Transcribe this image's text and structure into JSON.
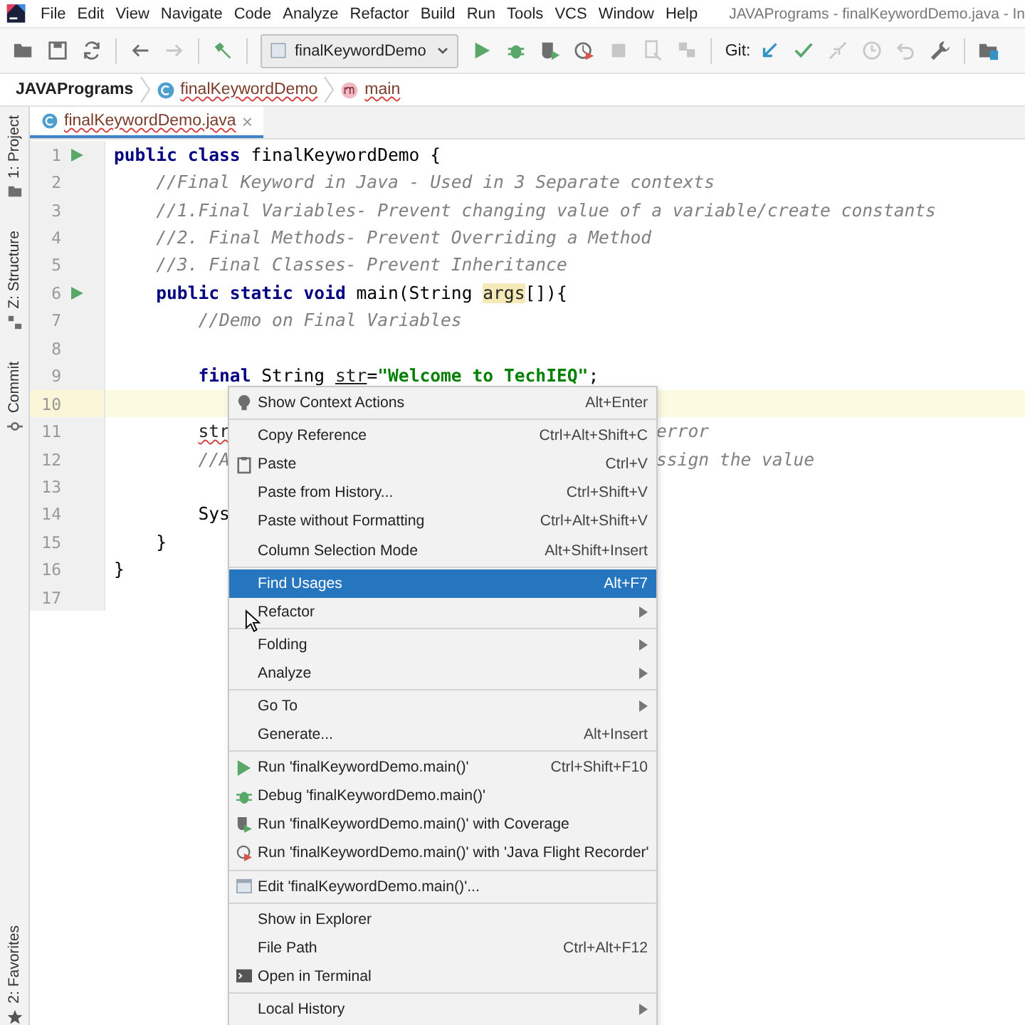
{
  "menu_bar": {
    "items": [
      "File",
      "Edit",
      "View",
      "Navigate",
      "Code",
      "Analyze",
      "Refactor",
      "Build",
      "Run",
      "Tools",
      "VCS",
      "Window",
      "Help"
    ],
    "title": "JAVAPrograms - finalKeywordDemo.java - In"
  },
  "toolbar": {
    "buttons": [
      {
        "kind": "open",
        "disabled": false
      },
      {
        "kind": "save",
        "disabled": false
      },
      {
        "kind": "sync",
        "disabled": false
      },
      {
        "kind": "back",
        "disabled": false
      },
      {
        "kind": "forward",
        "disabled": true
      },
      {
        "kind": "build",
        "disabled": false
      },
      {
        "kind": "config",
        "label": "finalKeywordDemo",
        "disabled": false
      },
      {
        "kind": "run",
        "disabled": false
      },
      {
        "kind": "debug",
        "disabled": false
      },
      {
        "kind": "coverage",
        "disabled": false
      },
      {
        "kind": "profile",
        "disabled": false
      },
      {
        "kind": "stop",
        "disabled": true
      },
      {
        "kind": "attach",
        "disabled": true
      },
      {
        "kind": "deploy",
        "disabled": true
      },
      {
        "kind": "git",
        "label": "Git:",
        "disabled": false
      },
      {
        "kind": "update",
        "disabled": false
      },
      {
        "kind": "commit",
        "disabled": false
      },
      {
        "kind": "merge",
        "disabled": true
      },
      {
        "kind": "history",
        "disabled": true
      },
      {
        "kind": "rollback",
        "disabled": true
      },
      {
        "kind": "settings",
        "disabled": false
      },
      {
        "kind": "structure",
        "disabled": false
      }
    ]
  },
  "breadcrumbs": [
    {
      "kind": "project",
      "text": "JAVAPrograms",
      "error": false
    },
    {
      "kind": "class",
      "text": "finalKeywordDemo",
      "error": true
    },
    {
      "kind": "method",
      "text": "main",
      "error": true
    }
  ],
  "side_stripe": [
    {
      "kind": "project",
      "label": "1: Project"
    },
    {
      "kind": "structure",
      "label": "Z: Structure"
    },
    {
      "kind": "commit",
      "label": "Commit"
    },
    {
      "kind": "favorites",
      "label": "2: Favorites"
    }
  ],
  "tabs": [
    {
      "label": "finalKeywordDemo.java",
      "selected": true,
      "error": true,
      "close": "×"
    }
  ],
  "editor": {
    "lines": [
      {
        "number": "1",
        "run_marker": true,
        "current": false,
        "segments": [
          {
            "kind": "keyword",
            "text": "public class "
          },
          {
            "kind": "plain",
            "text": "finalKeywordDemo {"
          }
        ]
      },
      {
        "number": "2",
        "run_marker": false,
        "current": false,
        "segments": [
          {
            "kind": "comment",
            "text": "    //Final Keyword in Java - Used in 3 Separate contexts"
          }
        ]
      },
      {
        "number": "3",
        "run_marker": false,
        "current": false,
        "segments": [
          {
            "kind": "comment",
            "text": "    //1.Final Variables- Prevent changing value of a variable/create constants"
          }
        ]
      },
      {
        "number": "4",
        "run_marker": false,
        "current": false,
        "segments": [
          {
            "kind": "comment",
            "text": "    //2. Final Methods- Prevent Overriding a Method"
          }
        ]
      },
      {
        "number": "5",
        "run_marker": false,
        "current": false,
        "segments": [
          {
            "kind": "comment",
            "text": "    //3. Final Classes- Prevent Inheritance"
          }
        ]
      },
      {
        "number": "6",
        "run_marker": true,
        "current": false,
        "segments": [
          {
            "kind": "keyword",
            "text": "    public static void "
          },
          {
            "kind": "plain",
            "text": "main(String "
          },
          {
            "kind": "param",
            "text": "args"
          },
          {
            "kind": "plain",
            "text": "[]){"
          }
        ]
      },
      {
        "number": "7",
        "run_marker": false,
        "current": false,
        "segments": [
          {
            "kind": "comment",
            "text": "        //Demo on Final Variables"
          }
        ]
      },
      {
        "number": "8",
        "run_marker": false,
        "current": false
      },
      {
        "number": "9",
        "run_marker": false,
        "current": false,
        "segments": [
          {
            "kind": "keyword",
            "text": "        final "
          },
          {
            "kind": "plain",
            "text": "String "
          },
          {
            "kind": "underlined",
            "text": "str"
          },
          {
            "kind": "plain",
            "text": "="
          },
          {
            "kind": "string",
            "text": "\"Welcome to TechIEQ\""
          },
          {
            "kind": "plain",
            "text": ";"
          }
        ]
      },
      {
        "number": "10",
        "run_marker": false,
        "current": true
      },
      {
        "number": "11",
        "run_marker": false,
        "current": false,
        "segments": [
          {
            "kind": "error",
            "text": "        str"
          }
        ],
        "tail": "error"
      },
      {
        "number": "12",
        "run_marker": false,
        "current": false,
        "segments": [
          {
            "kind": "comment",
            "text": "        //A"
          }
        ],
        "tail": "ssign the value"
      },
      {
        "number": "13",
        "run_marker": false,
        "current": false
      },
      {
        "number": "14",
        "run_marker": false,
        "current": false,
        "segments": [
          {
            "kind": "plain",
            "text": "        Sys"
          }
        ]
      },
      {
        "number": "15",
        "run_marker": false,
        "current": false,
        "segments": [
          {
            "kind": "plain",
            "text": "    }"
          }
        ]
      },
      {
        "number": "16",
        "run_marker": false,
        "current": false,
        "segments": [
          {
            "kind": "plain",
            "text": "}"
          }
        ]
      },
      {
        "number": "17",
        "run_marker": false,
        "current": false
      }
    ]
  },
  "context_menu": {
    "items": [
      {
        "kind": "bulb",
        "label": "Show Context Actions",
        "shortcut": "Alt+Enter",
        "submenu": false,
        "selected": false
      },
      {
        "kind": "separator"
      },
      {
        "kind": "item",
        "label": "Copy Reference",
        "shortcut": "Ctrl+Alt+Shift+C",
        "submenu": false,
        "selected": false
      },
      {
        "kind": "clipboard",
        "label": "Paste",
        "shortcut": "Ctrl+V",
        "submenu": false,
        "selected": false
      },
      {
        "kind": "item",
        "label": "Paste from History...",
        "shortcut": "Ctrl+Shift+V",
        "submenu": false,
        "selected": false
      },
      {
        "kind": "item",
        "label": "Paste without Formatting",
        "shortcut": "Ctrl+Alt+Shift+V",
        "submenu": false,
        "selected": false
      },
      {
        "kind": "item",
        "label": "Column Selection Mode",
        "shortcut": "Alt+Shift+Insert",
        "submenu": false,
        "selected": false
      },
      {
        "kind": "separator"
      },
      {
        "kind": "item",
        "label": "Find Usages",
        "shortcut": "Alt+F7",
        "submenu": false,
        "selected": true
      },
      {
        "kind": "item",
        "label": "Refactor",
        "submenu": true,
        "selected": false
      },
      {
        "kind": "separator"
      },
      {
        "kind": "item",
        "label": "Folding",
        "submenu": true,
        "selected": false
      },
      {
        "kind": "item",
        "label": "Analyze",
        "submenu": true,
        "selected": false
      },
      {
        "kind": "separator"
      },
      {
        "kind": "item",
        "label": "Go To",
        "submenu": true,
        "selected": false
      },
      {
        "kind": "item",
        "label": "Generate...",
        "shortcut": "Alt+Insert",
        "submenu": false,
        "selected": false
      },
      {
        "kind": "separator"
      },
      {
        "kind": "run",
        "label": "Run 'finalKeywordDemo.main()'",
        "shortcut": "Ctrl+Shift+F10",
        "submenu": false,
        "selected": false
      },
      {
        "kind": "debug",
        "label": "Debug 'finalKeywordDemo.main()'",
        "submenu": false,
        "selected": false
      },
      {
        "kind": "coverage",
        "label": "Run 'finalKeywordDemo.main()' with Coverage",
        "submenu": false,
        "selected": false
      },
      {
        "kind": "profile",
        "label": "Run 'finalKeywordDemo.main()' with 'Java Flight Recorder'",
        "submenu": false,
        "selected": false
      },
      {
        "kind": "separator"
      },
      {
        "kind": "config",
        "label": "Edit 'finalKeywordDemo.main()'...",
        "submenu": false,
        "selected": false
      },
      {
        "kind": "separator"
      },
      {
        "kind": "item",
        "label": "Show in Explorer",
        "submenu": false,
        "selected": false
      },
      {
        "kind": "item",
        "label": "File Path",
        "shortcut": "Ctrl+Alt+F12",
        "submenu": false,
        "selected": false
      },
      {
        "kind": "terminal",
        "label": "Open in Terminal",
        "submenu": false,
        "selected": false
      },
      {
        "kind": "separator"
      },
      {
        "kind": "item",
        "label": "Local History",
        "submenu": true,
        "selected": false
      }
    ]
  }
}
